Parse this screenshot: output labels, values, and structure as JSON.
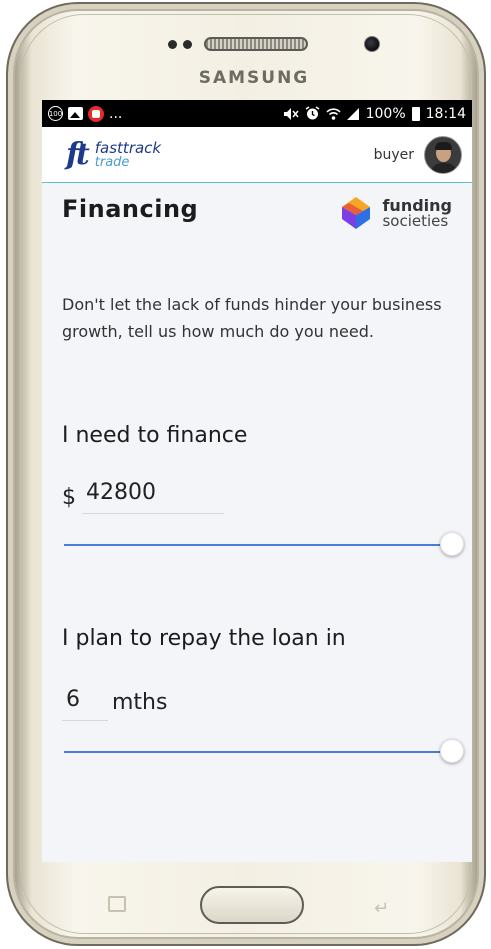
{
  "device": {
    "brand": "SAMSUNG"
  },
  "status_bar": {
    "left_icons": [
      "notification-circle-icon",
      "photo-icon",
      "youtube-icon"
    ],
    "overflow": "...",
    "right_icons": [
      "mute-icon",
      "alarm-icon",
      "wifi-icon",
      "signal-icon"
    ],
    "battery": "100%",
    "time": "18:14"
  },
  "app_bar": {
    "logo_mark": "ft",
    "logo_word1": "fasttrack",
    "logo_word2": "trade",
    "user_role": "buyer"
  },
  "page": {
    "title": "Financing",
    "partner": {
      "word1": "funding",
      "word2": "societies"
    },
    "intro": "Don't let the lack of funds hinder your business growth, tell us how much do you need."
  },
  "finance_amount": {
    "label": "I need to finance",
    "currency": "$",
    "value": "42800",
    "slider_position": 1.0
  },
  "repay_period": {
    "label": "I plan to repay the loan in",
    "value": "6",
    "unit": "mths",
    "slider_position": 1.0
  },
  "colors": {
    "accent": "#4a7bd6",
    "appbar_border": "#58c5c9",
    "status_bar": "#000000",
    "logo_primary": "#1e3a8a"
  }
}
